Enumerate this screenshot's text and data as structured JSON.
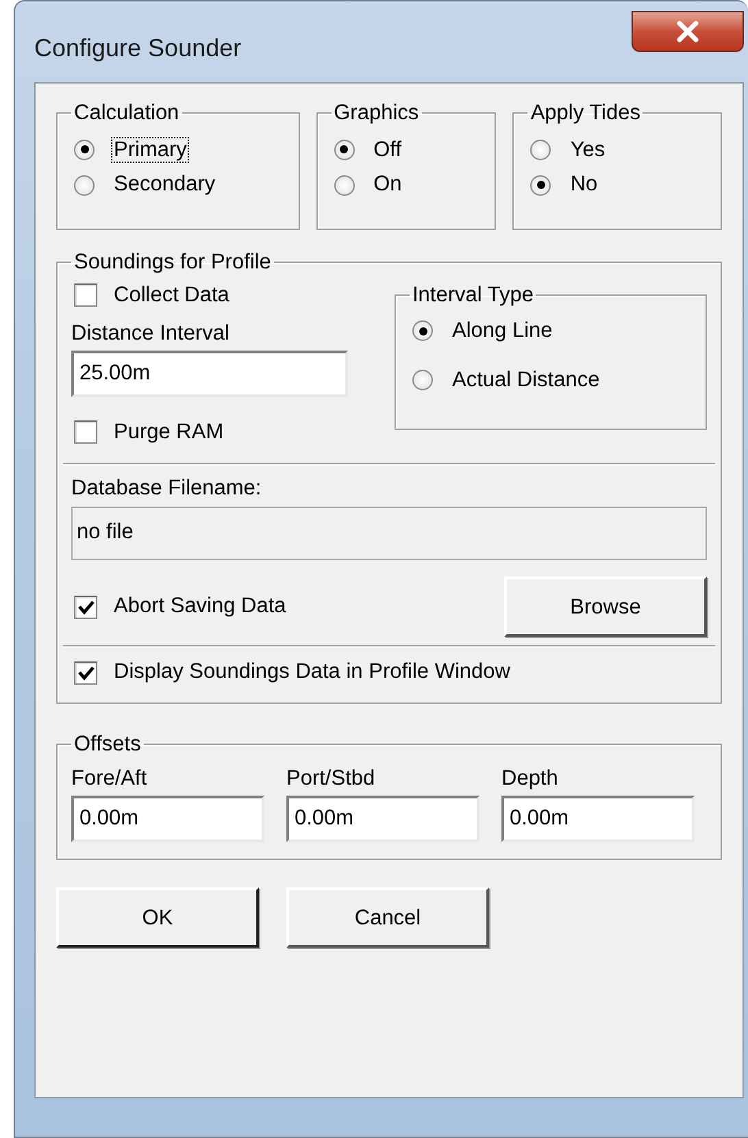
{
  "window": {
    "title": "Configure Sounder"
  },
  "calculation": {
    "label": "Calculation",
    "options": [
      {
        "label": "Primary",
        "selected": true,
        "focused": true
      },
      {
        "label": "Secondary",
        "selected": false,
        "focused": false
      }
    ]
  },
  "graphics": {
    "label": "Graphics",
    "options": [
      {
        "label": "Off",
        "selected": true,
        "focused": false
      },
      {
        "label": "On",
        "selected": false,
        "focused": false
      }
    ]
  },
  "apply_tides": {
    "label": "Apply Tides",
    "options": [
      {
        "label": "Yes",
        "selected": false,
        "focused": false
      },
      {
        "label": "No",
        "selected": true,
        "focused": false
      }
    ]
  },
  "soundings": {
    "label": "Soundings for Profile",
    "collect_data": {
      "label": "Collect Data",
      "checked": false
    },
    "distance_interval": {
      "label": "Distance Interval",
      "value": "25.00m"
    },
    "interval_type": {
      "label": "Interval Type",
      "options": [
        {
          "label": "Along Line",
          "selected": true,
          "focused": false
        },
        {
          "label": "Actual Distance",
          "selected": false,
          "focused": false
        }
      ]
    },
    "purge_ram": {
      "label": "Purge RAM",
      "checked": false
    },
    "database_filename": {
      "label": "Database Filename:",
      "value": "no file"
    },
    "abort_saving": {
      "label": "Abort Saving Data",
      "checked": true
    },
    "browse_button": "Browse",
    "display_soundings": {
      "label": "Display Soundings Data in Profile Window",
      "checked": true
    }
  },
  "offsets": {
    "label": "Offsets",
    "fields": [
      {
        "label": "Fore/Aft",
        "value": "0.00m"
      },
      {
        "label": "Port/Stbd",
        "value": "0.00m"
      },
      {
        "label": "Depth",
        "value": "0.00m"
      }
    ]
  },
  "buttons": [
    "OK",
    "Cancel"
  ]
}
